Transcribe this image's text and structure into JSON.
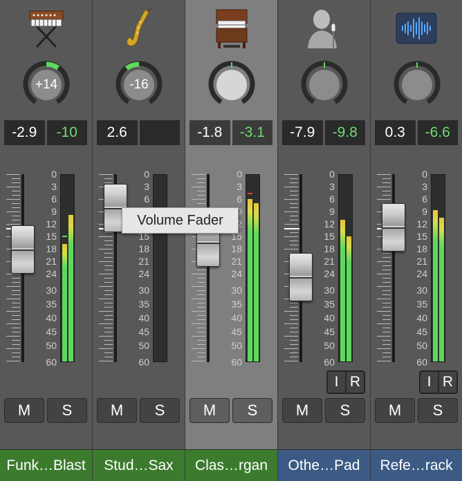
{
  "tooltip": "Volume Fader",
  "db_scale": [
    "0",
    "3",
    "6",
    "9",
    "12",
    "15",
    "18",
    "21",
    "24",
    "30",
    "35",
    "40",
    "45",
    "50",
    "60"
  ],
  "colors": {
    "meter_green": "#5ed85e",
    "peak_green": "#6fdc6f",
    "audio_tab": "#3c7b2e",
    "midi_tab": "#3b5b84",
    "tooltip_bg": "#e6e6e6"
  },
  "strips": [
    {
      "name": "Funk…Blast",
      "icon": "synth-keyboard-icon",
      "pan": "+14",
      "volume": "-2.9",
      "peak": "-10",
      "mute": "M",
      "solo": "S",
      "input": "",
      "record": "",
      "meter_l": 0.63,
      "meter_r": 0.78
    },
    {
      "name": "Stud…Sax",
      "icon": "saxophone-icon",
      "pan": "-16",
      "volume": "2.6",
      "peak": "",
      "mute": "M",
      "solo": "S",
      "input": "",
      "record": "",
      "meter_l": 0,
      "meter_r": 0
    },
    {
      "name": "Clas…rgan",
      "icon": "organ-icon",
      "pan": "",
      "volume": "-1.8",
      "peak": "-3.1",
      "mute": "M",
      "solo": "S",
      "input": "",
      "record": "",
      "meter_l": 0.87,
      "meter_r": 0.85
    },
    {
      "name": "Othe…Pad",
      "icon": "vocalist-icon",
      "pan": "",
      "volume": "-7.9",
      "peak": "-9.8",
      "mute": "M",
      "solo": "S",
      "input": "I",
      "record": "R",
      "meter_l": 0.76,
      "meter_r": 0.67
    },
    {
      "name": "Refe…rack",
      "icon": "waveform-icon",
      "pan": "",
      "volume": "0.3",
      "peak": "-6.6",
      "mute": "M",
      "solo": "S",
      "input": "I",
      "record": "R",
      "meter_l": 0.81,
      "meter_r": 0.77
    }
  ]
}
